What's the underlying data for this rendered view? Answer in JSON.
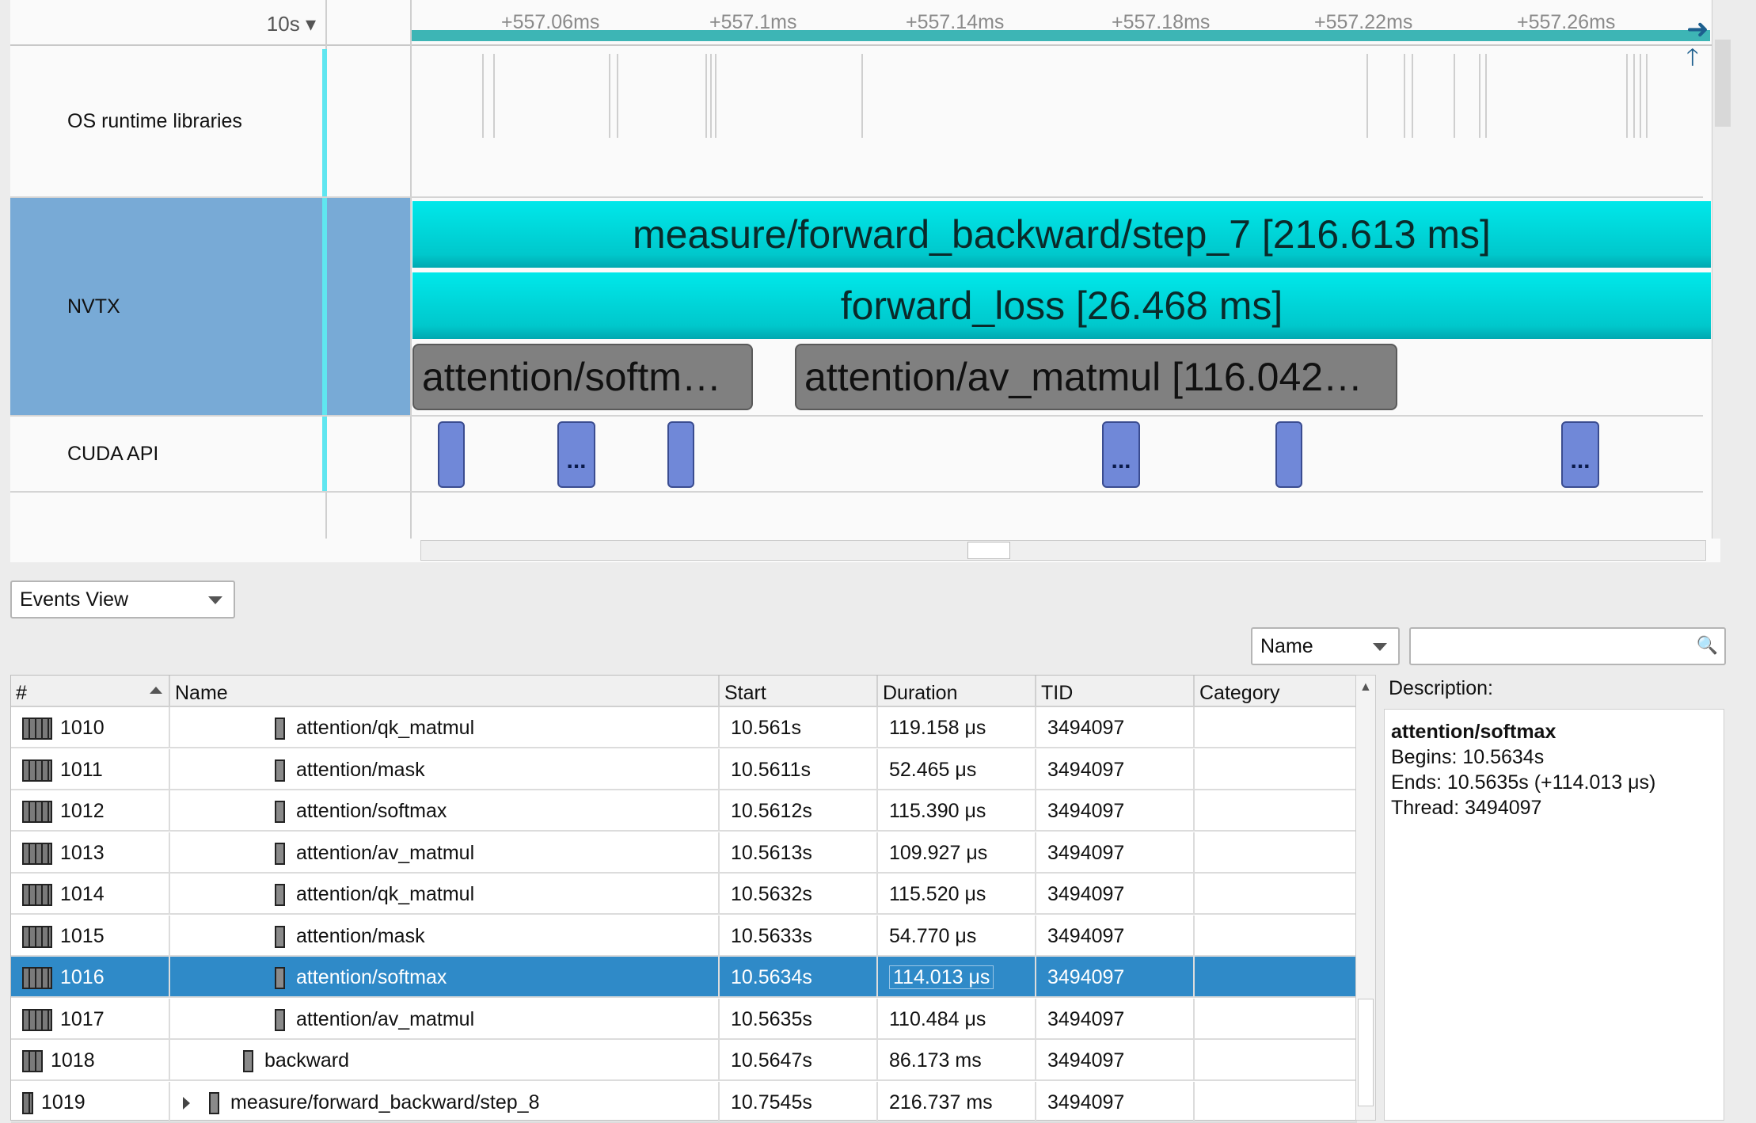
{
  "timeline": {
    "zoom": "10s",
    "ticks": [
      "+557.06ms",
      "+557.1ms",
      "+557.14ms",
      "+557.18ms",
      "+557.22ms",
      "+557.26ms"
    ],
    "rows": {
      "os": "OS runtime libraries",
      "nvtx": "NVTX",
      "cuda": "CUDA API"
    },
    "nvtx_bars": {
      "level1": "measure/forward_backward/step_7 [216.613 ms]",
      "level2": "forward_loss [26.468 ms]",
      "level3a": "attention/softm…",
      "level3b": "attention/av_matmul [116.042…"
    },
    "cuda_marker_more": "...",
    "colors": {
      "nvtx": "#00d7da",
      "selected_row": "#2f8ac8",
      "cuda_block": "#7088d8",
      "selected_label_bg": "#78aad6"
    }
  },
  "events": {
    "view_select": "Events View",
    "search_field": "Name",
    "search_value": "",
    "columns": [
      "#",
      "Name",
      "Start",
      "Duration",
      "TID",
      "Category"
    ],
    "rows": [
      {
        "num": "1010",
        "name": "attention/qk_matmul",
        "start": "10.561s",
        "duration": "119.158 μs",
        "tid": "3494097",
        "category": ""
      },
      {
        "num": "1011",
        "name": "attention/mask",
        "start": "10.5611s",
        "duration": "52.465 μs",
        "tid": "3494097",
        "category": ""
      },
      {
        "num": "1012",
        "name": "attention/softmax",
        "start": "10.5612s",
        "duration": "115.390 μs",
        "tid": "3494097",
        "category": ""
      },
      {
        "num": "1013",
        "name": "attention/av_matmul",
        "start": "10.5613s",
        "duration": "109.927 μs",
        "tid": "3494097",
        "category": ""
      },
      {
        "num": "1014",
        "name": "attention/qk_matmul",
        "start": "10.5632s",
        "duration": "115.520 μs",
        "tid": "3494097",
        "category": ""
      },
      {
        "num": "1015",
        "name": "attention/mask",
        "start": "10.5633s",
        "duration": "54.770 μs",
        "tid": "3494097",
        "category": ""
      },
      {
        "num": "1016",
        "name": "attention/softmax",
        "start": "10.5634s",
        "duration": "114.013 μs",
        "tid": "3494097",
        "category": ""
      },
      {
        "num": "1017",
        "name": "attention/av_matmul",
        "start": "10.5635s",
        "duration": "110.484 μs",
        "tid": "3494097",
        "category": ""
      },
      {
        "num": "1018",
        "name": "backward",
        "start": "10.5647s",
        "duration": "86.173 ms",
        "tid": "3494097",
        "category": ""
      },
      {
        "num": "1019",
        "name": "measure/forward_backward/step_8",
        "start": "10.7545s",
        "duration": "216.737 ms",
        "tid": "3494097",
        "category": ""
      }
    ],
    "selected_row": "1016"
  },
  "description": {
    "label": "Description:",
    "title": "attention/softmax",
    "begins": "Begins: 10.5634s",
    "ends": "Ends: 10.5635s (+114.013 μs)",
    "thread": "Thread: 3494097"
  }
}
